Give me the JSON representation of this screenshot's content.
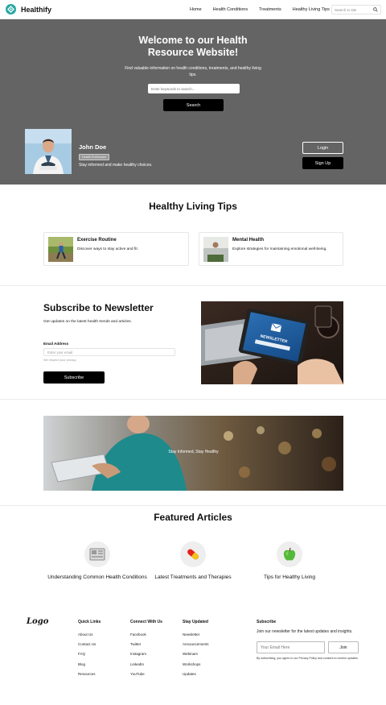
{
  "brand": {
    "name": "Healthify"
  },
  "nav": {
    "items": [
      "Home",
      "Health Conditions",
      "Treatments",
      "Healthy Living Tips"
    ],
    "search_placeholder": "Search in site"
  },
  "hero": {
    "title_line1": "Welcome to our Health",
    "title_line2": "Resource Website!",
    "subtitle": "Find valuable information on health conditions, treatments, and healthy living tips.",
    "search_placeholder": "Enter keywords to search...",
    "search_button": "Search"
  },
  "profile": {
    "name": "John Doe",
    "badge": "Health Enthusiast",
    "tagline": "Stay informed and make healthy choices.",
    "login_button": "Login",
    "signup_button": "Sign Up"
  },
  "tips": {
    "title": "Healthy Living Tips",
    "cards": [
      {
        "title": "Exercise Routine",
        "desc": "Discover ways to stay active and fit."
      },
      {
        "title": "Mental Health",
        "desc": "Explore strategies for maintaining emotional well-being."
      }
    ]
  },
  "newsletter": {
    "title": "Subscribe to Newsletter",
    "desc": "Get updates on the latest health trends and articles.",
    "email_label": "Email Address",
    "email_placeholder": "Enter your email",
    "note": "We respect your privacy",
    "button": "Subscribe",
    "image_word": "NEWSLETTER"
  },
  "banner": {
    "text": "Stay Informed, Stay Healthy"
  },
  "articles": {
    "title": "Featured Articles",
    "items": [
      {
        "title": "Understanding Common Health Conditions",
        "icon": "medical-record-icon"
      },
      {
        "title": "Latest Treatments and Therapies",
        "icon": "pill-icon"
      },
      {
        "title": "Tips for Healthy Living",
        "icon": "apple-icon"
      }
    ]
  },
  "footer": {
    "logo": "Logo",
    "columns": [
      {
        "title": "Quick Links",
        "links": [
          "About Us",
          "Contact Us",
          "FAQ",
          "Blog",
          "Resources"
        ]
      },
      {
        "title": "Connect With Us",
        "links": [
          "Facebook",
          "Twitter",
          "Instagram",
          "LinkedIn",
          "YouTube"
        ]
      },
      {
        "title": "Stay Updated",
        "links": [
          "Newsletter",
          "Announcements",
          "Webinars",
          "Workshops",
          "Updates"
        ]
      }
    ],
    "subscribe": {
      "title": "Subscribe",
      "desc": "Join our newsletter for the latest updates and insights.",
      "placeholder": "Your Email Here",
      "button": "Join",
      "note": "By subscribing, you agree to our Privacy Policy and consent to receive updates."
    }
  },
  "colors": {
    "brand": "#27a7a4",
    "hero_bg": "#646464",
    "button": "#000000"
  }
}
